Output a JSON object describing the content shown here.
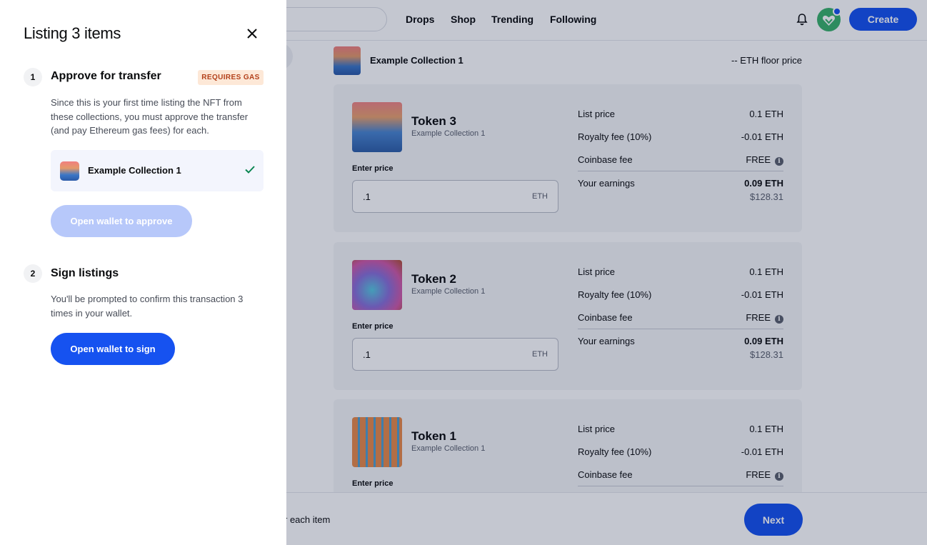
{
  "header": {
    "nav": [
      "Drops",
      "Shop",
      "Trending",
      "Following"
    ],
    "create_label": "Create",
    "icons": {
      "notifications": "bell-icon",
      "avatar": "user-avatar"
    }
  },
  "collection": {
    "name": "Example Collection 1",
    "floor_price": "-- ETH floor price"
  },
  "tokens": [
    {
      "name": "Token 3",
      "collection": "Example Collection 1",
      "enter_price_label": "Enter price",
      "price_value": ".1",
      "price_unit": "ETH",
      "fees": [
        {
          "label": "List price",
          "value": "0.1 ETH"
        },
        {
          "label": "Royalty fee (10%)",
          "value": "-0.01 ETH"
        },
        {
          "label": "Coinbase fee",
          "value": "FREE"
        }
      ],
      "earnings_label": "Your earnings",
      "earnings_eth": "0.09 ETH",
      "earnings_usd": "$128.31"
    },
    {
      "name": "Token 2",
      "collection": "Example Collection 1",
      "enter_price_label": "Enter price",
      "price_value": ".1",
      "price_unit": "ETH",
      "fees": [
        {
          "label": "List price",
          "value": "0.1 ETH"
        },
        {
          "label": "Royalty fee (10%)",
          "value": "-0.01 ETH"
        },
        {
          "label": "Coinbase fee",
          "value": "FREE"
        }
      ],
      "earnings_label": "Your earnings",
      "earnings_eth": "0.09 ETH",
      "earnings_usd": "$128.31"
    },
    {
      "name": "Token 1",
      "collection": "Example Collection 1",
      "enter_price_label": "Enter price",
      "fees": [
        {
          "label": "List price",
          "value": "0.1 ETH"
        },
        {
          "label": "Royalty fee (10%)",
          "value": "-0.01 ETH"
        },
        {
          "label": "Coinbase fee",
          "value": "FREE"
        }
      ]
    }
  ],
  "footer": {
    "partial_text": "r each item",
    "next_label": "Next"
  },
  "panel": {
    "title": "Listing 3 items",
    "close_icon": "close-icon",
    "step1": {
      "number": "1",
      "title": "Approve for transfer",
      "badge": "REQUIRES GAS",
      "description": "Since this is your first time listing the NFT from these collections, you must approve the transfer (and pay Ethereum gas fees) for each.",
      "collection_name": "Example Collection 1",
      "status_icon": "checkmark-icon",
      "button_label": "Open wallet to approve"
    },
    "step2": {
      "number": "2",
      "title": "Sign listings",
      "description": "You'll be prompted to confirm this transaction 3 times in your wallet.",
      "button_label": "Open wallet to sign"
    }
  }
}
